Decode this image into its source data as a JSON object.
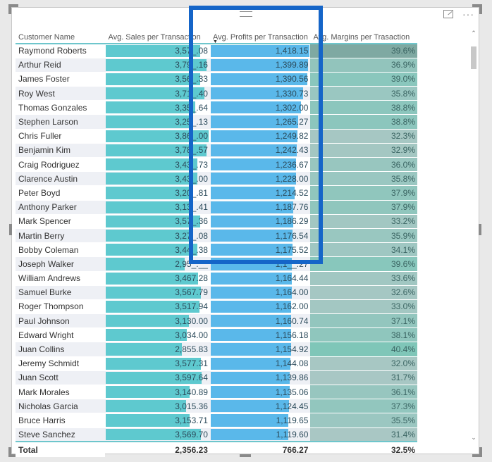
{
  "visual": {
    "more_options_label": "···",
    "columns": [
      {
        "label": "Customer Name"
      },
      {
        "label": "Avg. Sales per Transaction"
      },
      {
        "label": "Avg. Profits per Transaction",
        "sorted": "descending"
      },
      {
        "label": "Avg. Margins per Trasaction"
      }
    ],
    "rows": [
      {
        "name": "Raymond Roberts",
        "sales": "3,57_.08",
        "sales_frac": 0.92,
        "profit": "1,418.15",
        "profit_frac": 1.0,
        "margin": "39.6%",
        "margin_color": "#7fa9a2"
      },
      {
        "name": "Arthur Reid",
        "sales": "3,79_.16",
        "sales_frac": 0.98,
        "profit": "1,399.89",
        "profit_frac": 0.985,
        "margin": "36.9%",
        "margin_color": "#92c4bc"
      },
      {
        "name": "James Foster",
        "sales": "3,56_.33",
        "sales_frac": 0.92,
        "profit": "1,390.56",
        "profit_frac": 0.98,
        "margin": "39.0%",
        "margin_color": "#8ac7bd"
      },
      {
        "name": "Roy West",
        "sales": "3,71_.40",
        "sales_frac": 0.96,
        "profit": "1,330.73",
        "profit_frac": 0.94,
        "margin": "35.8%",
        "margin_color": "#9ac7c1"
      },
      {
        "name": "Thomas Gonzales",
        "sales": "3,35_.64",
        "sales_frac": 0.87,
        "profit": "1,302.00",
        "profit_frac": 0.92,
        "margin": "38.8%",
        "margin_color": "#8cc6bd"
      },
      {
        "name": "Stephen Larson",
        "sales": "3,25_.13",
        "sales_frac": 0.84,
        "profit": "1,265.27",
        "profit_frac": 0.89,
        "margin": "38.8%",
        "margin_color": "#8cc6bd"
      },
      {
        "name": "Chris Fuller",
        "sales": "3,86_.00",
        "sales_frac": 1.0,
        "profit": "1,249.82",
        "profit_frac": 0.88,
        "margin": "32.3%",
        "margin_color": "#a6c7c3"
      },
      {
        "name": "Benjamin Kim",
        "sales": "3,78_.57",
        "sales_frac": 0.98,
        "profit": "1,242.43",
        "profit_frac": 0.875,
        "margin": "32.9%",
        "margin_color": "#a4c7c2"
      },
      {
        "name": "Craig Rodriguez",
        "sales": "3,43_.73",
        "sales_frac": 0.89,
        "profit": "1,236.67",
        "profit_frac": 0.87,
        "margin": "36.0%",
        "margin_color": "#98c6bf"
      },
      {
        "name": "Clarence Austin",
        "sales": "3,43_.00",
        "sales_frac": 0.89,
        "profit": "1,228.00",
        "profit_frac": 0.866,
        "margin": "35.8%",
        "margin_color": "#9ac7c1"
      },
      {
        "name": "Peter Boyd",
        "sales": "3,20_.81",
        "sales_frac": 0.83,
        "profit": "1,214.52",
        "profit_frac": 0.856,
        "margin": "37.9%",
        "margin_color": "#90c6bd"
      },
      {
        "name": "Anthony Parker",
        "sales": "3,13_.41",
        "sales_frac": 0.81,
        "profit": "1,187.76",
        "profit_frac": 0.837,
        "margin": "37.9%",
        "margin_color": "#90c6bd"
      },
      {
        "name": "Mark Spencer",
        "sales": "3,57_.36",
        "sales_frac": 0.92,
        "profit": "1,186.29",
        "profit_frac": 0.836,
        "margin": "33.2%",
        "margin_color": "#a2c7c2"
      },
      {
        "name": "Martin Berry",
        "sales": "3,27_.08",
        "sales_frac": 0.85,
        "profit": "1,176.54",
        "profit_frac": 0.83,
        "margin": "35.9%",
        "margin_color": "#99c7c0"
      },
      {
        "name": "Bobby Coleman",
        "sales": "3,44_.38",
        "sales_frac": 0.89,
        "profit": "1,175.52",
        "profit_frac": 0.829,
        "margin": "34.1%",
        "margin_color": "#9fc7c2"
      },
      {
        "name": "Joseph Walker",
        "sales": "2,95_.__",
        "sales_frac": 0.765,
        "profit": "1,1__.27",
        "profit_frac": 0.826,
        "margin": "39.6%",
        "margin_color": "#88c7bc"
      },
      {
        "name": "William Andrews",
        "sales": "3,467.28",
        "sales_frac": 0.9,
        "profit": "1,164.44",
        "profit_frac": 0.821,
        "margin": "33.6%",
        "margin_color": "#a1c7c2"
      },
      {
        "name": "Samuel Burke",
        "sales": "3,567.79",
        "sales_frac": 0.924,
        "profit": "1,164.00",
        "profit_frac": 0.821,
        "margin": "32.6%",
        "margin_color": "#a5c7c3"
      },
      {
        "name": "Roger Thompson",
        "sales": "3,517.94",
        "sales_frac": 0.911,
        "profit": "1,162.00",
        "profit_frac": 0.819,
        "margin": "33.0%",
        "margin_color": "#a3c7c2"
      },
      {
        "name": "Paul Johnson",
        "sales": "3,130.00",
        "sales_frac": 0.81,
        "profit": "1,160.74",
        "profit_frac": 0.818,
        "margin": "37.1%",
        "margin_color": "#93c6be"
      },
      {
        "name": "Edward Wright",
        "sales": "3,034.00",
        "sales_frac": 0.786,
        "profit": "1,156.18",
        "profit_frac": 0.815,
        "margin": "38.1%",
        "margin_color": "#8fc6bd"
      },
      {
        "name": "Juan Collins",
        "sales": "2,855.83",
        "sales_frac": 0.74,
        "profit": "1,154.92",
        "profit_frac": 0.814,
        "margin": "40.4%",
        "margin_color": "#7fc6b8"
      },
      {
        "name": "Jeremy Schmidt",
        "sales": "3,577.31",
        "sales_frac": 0.927,
        "profit": "1,144.08",
        "profit_frac": 0.807,
        "margin": "32.0%",
        "margin_color": "#a7c7c3"
      },
      {
        "name": "Juan Scott",
        "sales": "3,597.64",
        "sales_frac": 0.932,
        "profit": "1,139.86",
        "profit_frac": 0.804,
        "margin": "31.7%",
        "margin_color": "#a8c7c4"
      },
      {
        "name": "Mark Morales",
        "sales": "3,140.89",
        "sales_frac": 0.813,
        "profit": "1,135.06",
        "profit_frac": 0.8,
        "margin": "36.1%",
        "margin_color": "#97c6bf"
      },
      {
        "name": "Nicholas Garcia",
        "sales": "3,015.36",
        "sales_frac": 0.781,
        "profit": "1,124.45",
        "profit_frac": 0.793,
        "margin": "37.3%",
        "margin_color": "#92c6be"
      },
      {
        "name": "Bruce Harris",
        "sales": "3,153.71",
        "sales_frac": 0.817,
        "profit": "1,119.65",
        "profit_frac": 0.79,
        "margin": "35.5%",
        "margin_color": "#9bc7c1"
      },
      {
        "name": "Steve Sanchez",
        "sales": "3,569.70",
        "sales_frac": 0.925,
        "profit": "1,119.60",
        "profit_frac": 0.79,
        "margin": "31.4%",
        "margin_color": "#a9c7c4"
      }
    ],
    "total": {
      "label": "Total",
      "sales": "2,356.23",
      "profit": "766.27",
      "margin": "32.5%"
    },
    "colors": {
      "sales_bar": "#5ec9cf",
      "profit_bar": "#5ab8ea",
      "highlight_box": "#1565c8",
      "header_underline": "#6ec6cc"
    }
  }
}
